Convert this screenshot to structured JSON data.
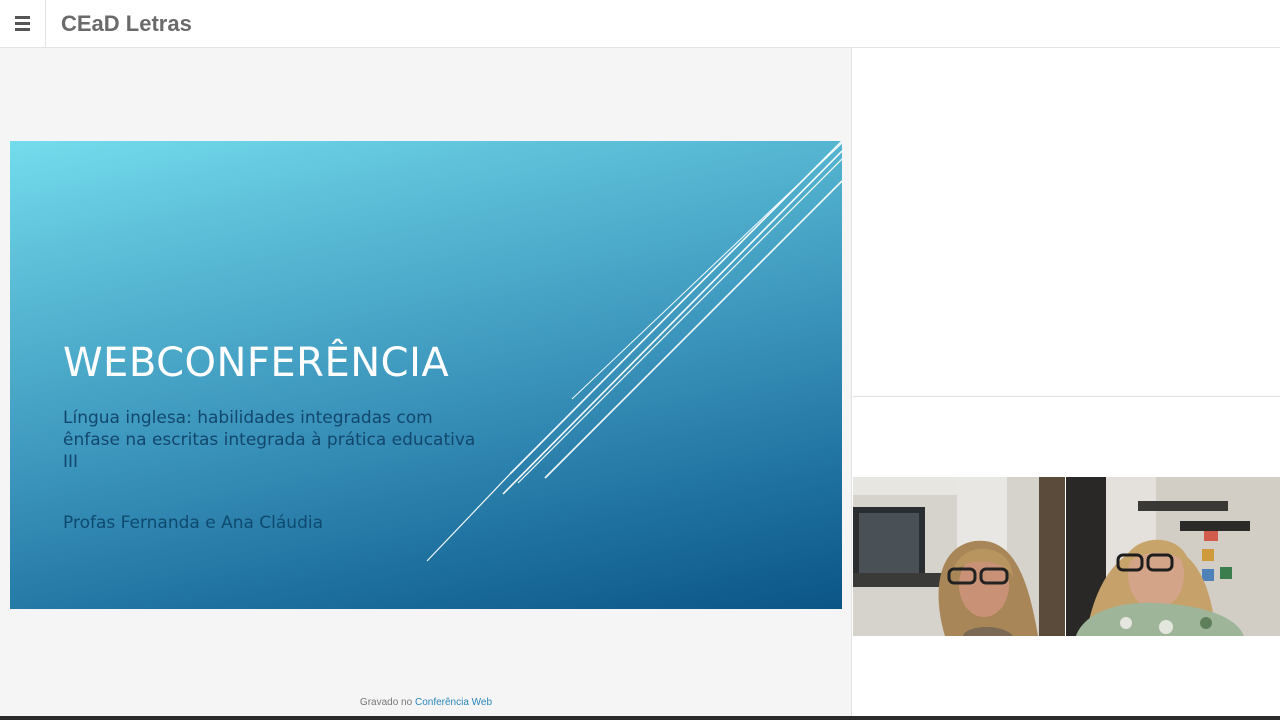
{
  "header": {
    "menu_icon": "hamburger-menu-icon",
    "title": "CEaD Letras"
  },
  "slide": {
    "title": "WEBCONFERÊNCIA",
    "subtitle": "Língua inglesa: habilidades integradas com ênfase na escritas integrada à prática educativa III",
    "authors": "Profas  Fernanda e Ana Cláudia",
    "colors": {
      "gradient_top": "#74dced",
      "gradient_bottom": "#0b5586",
      "title": "#ffffff",
      "text": "#12476d"
    }
  },
  "footer": {
    "prefix": "Gravado no",
    "link": "Conferência Web"
  },
  "webcams": [
    {
      "name": "participant-1-video"
    },
    {
      "name": "participant-2-video"
    }
  ]
}
